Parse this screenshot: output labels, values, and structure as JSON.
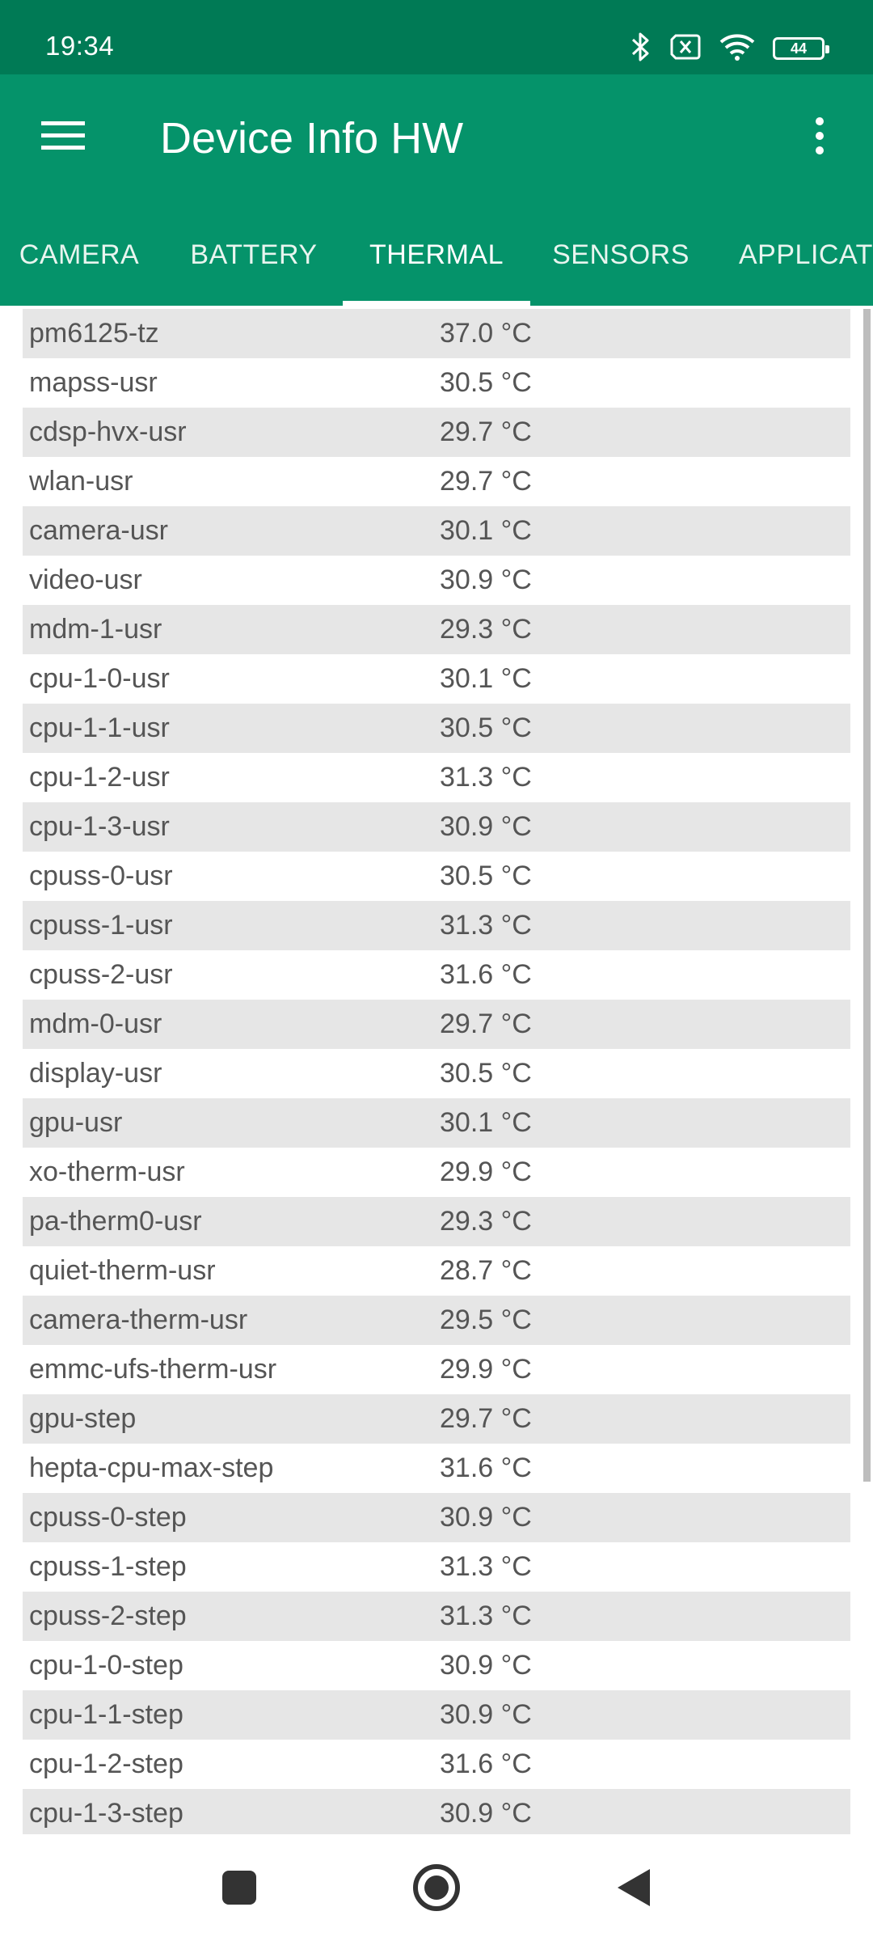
{
  "status_bar": {
    "time": "19:34",
    "icons": [
      "bluetooth-icon",
      "no-sim-icon",
      "wifi-icon",
      "battery-icon"
    ],
    "battery_level": "44"
  },
  "toolbar": {
    "title": "Device Info HW",
    "menu_icon": "hamburger-menu-icon",
    "overflow_icon": "more-vert-icon"
  },
  "tabs": [
    {
      "label": "CAMERA"
    },
    {
      "label": "BATTERY"
    },
    {
      "label": "THERMAL",
      "active": true
    },
    {
      "label": "SENSORS"
    },
    {
      "label": "APPLICAT"
    }
  ],
  "thermal": {
    "rows": [
      {
        "name": "pm6125-tz",
        "value": "37.0 °C"
      },
      {
        "name": "mapss-usr",
        "value": "30.5 °C"
      },
      {
        "name": "cdsp-hvx-usr",
        "value": "29.7 °C"
      },
      {
        "name": "wlan-usr",
        "value": "29.7 °C"
      },
      {
        "name": "camera-usr",
        "value": "30.1 °C"
      },
      {
        "name": "video-usr",
        "value": "30.9 °C"
      },
      {
        "name": "mdm-1-usr",
        "value": "29.3 °C"
      },
      {
        "name": "cpu-1-0-usr",
        "value": "30.1 °C"
      },
      {
        "name": "cpu-1-1-usr",
        "value": "30.5 °C"
      },
      {
        "name": "cpu-1-2-usr",
        "value": "31.3 °C"
      },
      {
        "name": "cpu-1-3-usr",
        "value": "30.9 °C"
      },
      {
        "name": "cpuss-0-usr",
        "value": "30.5 °C"
      },
      {
        "name": "cpuss-1-usr",
        "value": "31.3 °C"
      },
      {
        "name": "cpuss-2-usr",
        "value": "31.6 °C"
      },
      {
        "name": "mdm-0-usr",
        "value": "29.7 °C"
      },
      {
        "name": "display-usr",
        "value": "30.5 °C"
      },
      {
        "name": "gpu-usr",
        "value": "30.1 °C"
      },
      {
        "name": "xo-therm-usr",
        "value": "29.9 °C"
      },
      {
        "name": "pa-therm0-usr",
        "value": "29.3 °C"
      },
      {
        "name": "quiet-therm-usr",
        "value": "28.7 °C"
      },
      {
        "name": "camera-therm-usr",
        "value": "29.5 °C"
      },
      {
        "name": "emmc-ufs-therm-usr",
        "value": "29.9 °C"
      },
      {
        "name": "gpu-step",
        "value": "29.7 °C"
      },
      {
        "name": "hepta-cpu-max-step",
        "value": "31.6 °C"
      },
      {
        "name": "cpuss-0-step",
        "value": "30.9 °C"
      },
      {
        "name": "cpuss-1-step",
        "value": "31.3 °C"
      },
      {
        "name": "cpuss-2-step",
        "value": "31.3 °C"
      },
      {
        "name": "cpu-1-0-step",
        "value": "30.9 °C"
      },
      {
        "name": "cpu-1-1-step",
        "value": "30.9 °C"
      },
      {
        "name": "cpu-1-2-step",
        "value": "31.6 °C"
      },
      {
        "name": "cpu-1-3-step",
        "value": "30.9 °C"
      }
    ]
  },
  "nav_bar": {
    "icons": [
      "recents-icon",
      "home-icon",
      "back-icon"
    ]
  },
  "colors": {
    "status_bar": "#007A55",
    "app_bar": "#05936A",
    "row_alt": "#E6E6E6",
    "row_text": "#555555"
  }
}
